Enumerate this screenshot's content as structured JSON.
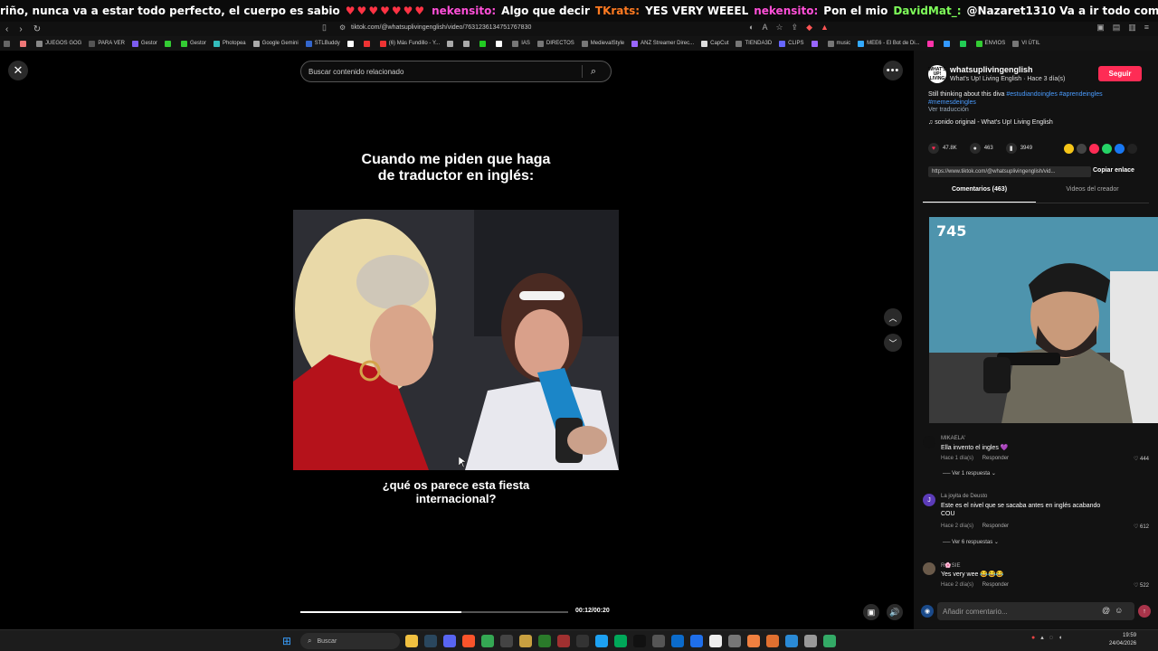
{
  "ticker": {
    "text1": "riño, nunca va a estar todo perfecto, el cuerpo es sabio",
    "user1": "nekensito:",
    "msg1": "Algo que decir",
    "user2": "TKrats:",
    "msg2": "YES VERY WEEEL",
    "user3": "nekensito:",
    "msg3": "Pon el mio",
    "user4": "DavidMat_:",
    "msg4": "@Nazaret1310 Va a ir todo como la seda!"
  },
  "browser": {
    "url": "tiktok.com/@whatsuplivingenglish/video/7631236134751767830",
    "bookmarks": [
      "JUEGOS GOG",
      "PARA VER",
      "Gestor",
      "Gestor",
      "Photopea",
      "Google Gemini",
      "STLBuddy",
      "X",
      "(6) Más Fundillo - Y...",
      "",
      "",
      "",
      "",
      "IAS",
      "DIRECTOS",
      "MedievalStyle",
      "ANZ Streamer Direc...",
      "CapCut",
      "TIENDA3D",
      "CLIPS",
      "",
      "music",
      "MEE6 - El Bot de Di...",
      "",
      "",
      "",
      "ENVIOS",
      "VI ÚTIL"
    ]
  },
  "search": {
    "placeholder": "Buscar contenido relacionado"
  },
  "video": {
    "caption_top_1": "Cuando me piden que haga",
    "caption_top_2": "de traductor en inglés:",
    "caption_bottom_1": "¿qué os parece esta fiesta",
    "caption_bottom_2": "internacional?",
    "progress": 0.6,
    "time": "00:12/00:20"
  },
  "post": {
    "username": "whatsuplivingenglish",
    "avatar_text": "WHAT'S UP! LIVING",
    "subtitle": "What's Up! Living English · Hace 3 día(s)",
    "follow": "Seguir",
    "desc": "Still thinking about this diva ",
    "tag1": "#estudiandoingles",
    "tag2": "#aprendeingles",
    "tag3": "#memesdeingles",
    "translate": "Ver traducción",
    "sound": "♫  sonido original - What's Up! Living English",
    "likes": "47.8K",
    "comments": "463",
    "saves": "3949",
    "link": "https://www.tiktok.com/@whatsuplivingenglish/vid...",
    "copy_link": "Copiar enlace",
    "tab_comments": "Comentarios (463)",
    "tab_videos": "Videos del creador"
  },
  "comments": [
    {
      "user": "MIKAELA'",
      "text": "Ella invento el ingles 💜",
      "time": "Hace 1 día(s)",
      "reply": "Responder",
      "likes": "444",
      "more": "Ver 1 respuesta",
      "avatar": ""
    },
    {
      "user": "La joyita de Deusto",
      "text": "Este es el nivel que se sacaba antes en inglés acabando COU",
      "time": "Hace 2 día(s)",
      "reply": "Responder",
      "likes": "612",
      "more": "Ver 6 respuestas",
      "avatar": "J"
    },
    {
      "user": "R🌸SIE",
      "text": "Yes very wee 😂😂😂",
      "time": "Hace 2 día(s)",
      "reply": "Responder",
      "likes": "522",
      "more": "",
      "avatar": ""
    }
  ],
  "comment_input": {
    "placeholder": "Añadir comentario..."
  },
  "webcam": {
    "count": "745"
  },
  "taskbar": {
    "search": "Buscar",
    "date": "24/04/2026",
    "time": "19:59"
  }
}
